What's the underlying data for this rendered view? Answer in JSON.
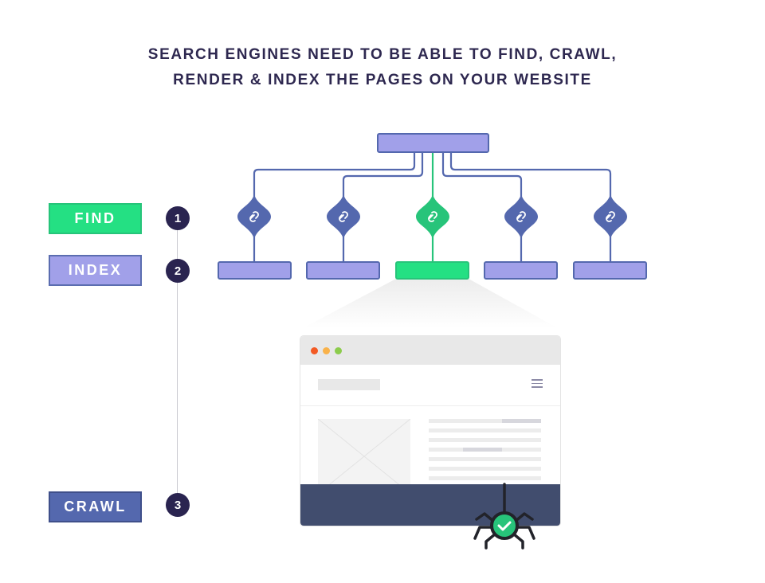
{
  "title": {
    "line1": "SEARCH ENGINES NEED TO BE ABLE TO FIND, CRAWL,",
    "line2": "RENDER & INDEX THE PAGES ON YOUR WEBSITE"
  },
  "steps": [
    {
      "label": "FIND",
      "number": "1",
      "color": "#24e083"
    },
    {
      "label": "INDEX",
      "number": "2",
      "color": "#a1a0e9"
    },
    {
      "label": "CRAWL",
      "number": "3",
      "color": "#5468ae"
    }
  ],
  "tree": {
    "root": {
      "name": "site-root",
      "color": "#a1a0e9"
    },
    "branches": [
      {
        "name": "page-1",
        "link_icon": "link-icon",
        "highlighted": false
      },
      {
        "name": "page-2",
        "link_icon": "link-icon",
        "highlighted": false
      },
      {
        "name": "page-3",
        "link_icon": "link-icon",
        "highlighted": true
      },
      {
        "name": "page-4",
        "link_icon": "link-icon",
        "highlighted": false
      },
      {
        "name": "page-5",
        "link_icon": "link-icon",
        "highlighted": false
      }
    ],
    "colors": {
      "line": "#5468ae",
      "node": "#a1a0e9",
      "highlight": "#24e083",
      "highlight_dark": "#27c47a"
    }
  },
  "browser": {
    "traffic_lights": [
      "#f35a24",
      "#f9b24a",
      "#8ccc4c"
    ],
    "menu_icon": "hamburger-menu-icon",
    "image_placeholder": "image-placeholder-icon",
    "footer_color": "#414d6e"
  },
  "crawler": {
    "icon": "spider-icon",
    "status_icon": "check-icon",
    "status_color": "#27c47a"
  }
}
